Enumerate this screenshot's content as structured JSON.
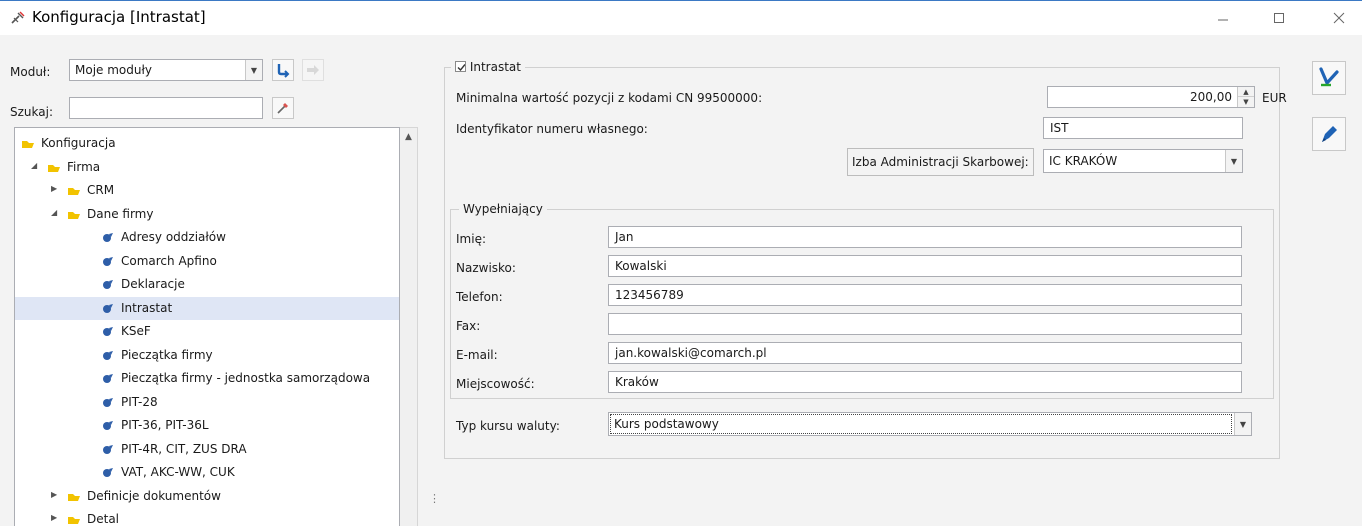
{
  "window": {
    "title": "Konfiguracja [Intrastat]"
  },
  "left": {
    "module_label": "Moduł:",
    "module_value": "Moje moduły",
    "search_label": "Szukaj:",
    "search_value": ""
  },
  "tree": [
    {
      "label": "Konfiguracja",
      "level": 0,
      "icon": "folder-icon",
      "expand": ""
    },
    {
      "label": "Firma",
      "level": 1,
      "icon": "folder-icon",
      "expand": "expanded"
    },
    {
      "label": "CRM",
      "level": 2,
      "icon": "folder-icon",
      "expand": "collapsed"
    },
    {
      "label": "Dane firmy",
      "level": 2,
      "icon": "folder-icon",
      "expand": "expanded"
    },
    {
      "label": "Adresy oddziałów",
      "level": 3,
      "icon": "leaf-icon",
      "expand": ""
    },
    {
      "label": "Comarch Apfino",
      "level": 3,
      "icon": "leaf-icon",
      "expand": ""
    },
    {
      "label": "Deklaracje",
      "level": 3,
      "icon": "leaf-icon",
      "expand": ""
    },
    {
      "label": "Intrastat",
      "level": 3,
      "icon": "leaf-icon",
      "expand": "",
      "selected": true
    },
    {
      "label": "KSeF",
      "level": 3,
      "icon": "leaf-icon",
      "expand": ""
    },
    {
      "label": "Pieczątka firmy",
      "level": 3,
      "icon": "leaf-icon",
      "expand": ""
    },
    {
      "label": "Pieczątka firmy - jednostka samorządowa",
      "level": 3,
      "icon": "leaf-icon",
      "expand": ""
    },
    {
      "label": "PIT-28",
      "level": 3,
      "icon": "leaf-icon",
      "expand": ""
    },
    {
      "label": "PIT-36, PIT-36L",
      "level": 3,
      "icon": "leaf-icon",
      "expand": ""
    },
    {
      "label": "PIT-4R, CIT, ZUS DRA",
      "level": 3,
      "icon": "leaf-icon",
      "expand": ""
    },
    {
      "label": "VAT, AKC-WW, CUK",
      "level": 3,
      "icon": "leaf-icon",
      "expand": ""
    },
    {
      "label": "Definicje dokumentów",
      "level": 2,
      "icon": "folder-icon",
      "expand": "collapsed"
    },
    {
      "label": "Detal",
      "level": 2,
      "icon": "folder-icon",
      "expand": "collapsed"
    }
  ],
  "intrastat": {
    "group_label": "Intrastat",
    "checked": true,
    "min_value_label": "Minimalna wartość pozycji z kodami CN 99500000:",
    "min_value": "200,00",
    "currency": "EUR",
    "id_label": "Identyfikator numeru własnego:",
    "id_value": "IST",
    "izba_label": "Izba Administracji Skarbowej:",
    "izba_value": "IC KRAKÓW",
    "filler": {
      "group_label": "Wypełniający",
      "first_name_label": "Imię:",
      "first_name": "Jan",
      "last_name_label": "Nazwisko:",
      "last_name": "Kowalski",
      "phone_label": "Telefon:",
      "phone": "123456789",
      "fax_label": "Fax:",
      "fax": "",
      "email_label": "E-mail:",
      "email": "jan.kowalski@comarch.pl",
      "city_label": "Miejscowość:",
      "city": "Kraków"
    },
    "rate_label": "Typ kursu waluty:",
    "rate_value": "Kurs podstawowy"
  },
  "colors": {
    "accent": "#3b79c4",
    "folder": "#f2c300",
    "leaf": "#2e5ea8",
    "selected": "#dfe6f5"
  }
}
